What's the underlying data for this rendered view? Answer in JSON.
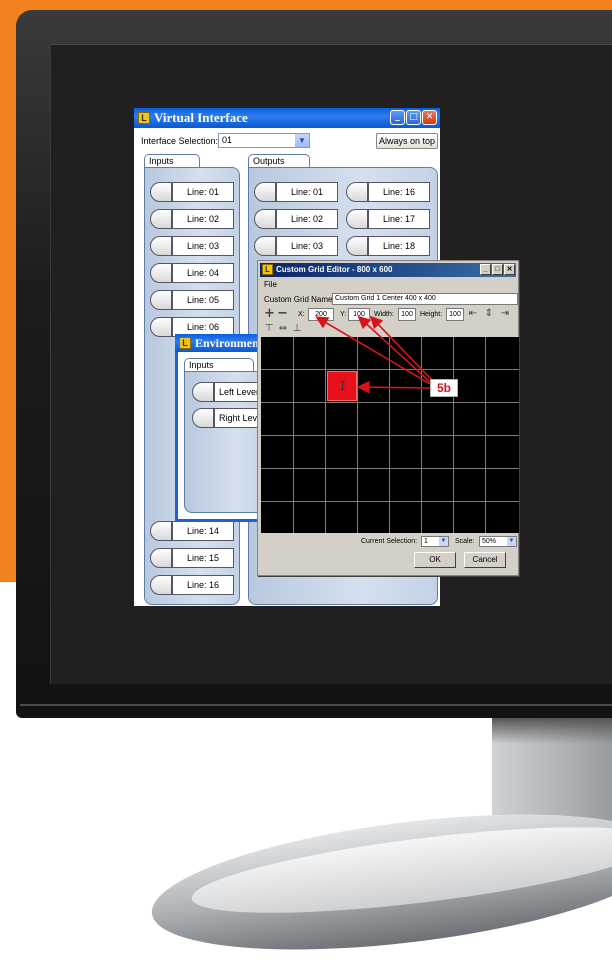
{
  "virtual_interface": {
    "title": "Virtual Interface",
    "selection_label": "Interface Selection:",
    "selection_value": "01",
    "always_on_top": "Always on top",
    "inputs_tab": "Inputs",
    "outputs_tab": "Outputs",
    "inputs": [
      "Line: 01",
      "Line: 02",
      "Line: 03",
      "Line: 04",
      "Line: 05",
      "Line: 06",
      "Line: 14",
      "Line: 15",
      "Line: 16"
    ],
    "outputs_col1": [
      "Line: 01",
      "Line: 02",
      "Line: 03"
    ],
    "outputs_col2": [
      "Line: 16",
      "Line: 17",
      "Line: 18"
    ]
  },
  "environment": {
    "title": "Environment",
    "inputs_tab": "Inputs",
    "levers": [
      "Left Lever",
      "Right Lever"
    ]
  },
  "grid_editor": {
    "title": "Custom Grid Editor - 800 x 600",
    "menu_file": "File",
    "name_label": "Custom Grid Name:",
    "name_value": "Custom Grid 1 Center 400 x 400",
    "x_label": "X:",
    "x_value": "200",
    "y_label": "Y:",
    "y_value": "100",
    "width_label": "Width:",
    "width_value": "100",
    "height_label": "Height:",
    "height_value": "100",
    "current_selection_label": "Current Selection:",
    "current_selection_value": "1",
    "scale_label": "Scale:",
    "scale_value": "50%",
    "ok": "OK",
    "cancel": "Cancel"
  },
  "annotation": {
    "label": "5b",
    "color": "#d7141b"
  },
  "colors": {
    "orange": "#f0821e",
    "screen": "#221f20",
    "selected_cell": "#e8101a"
  },
  "icons": [
    "app-icon",
    "minimize-icon",
    "maximize-icon",
    "close-icon",
    "add-icon",
    "remove-icon",
    "align-icon",
    "ibeam-cursor-icon",
    "dropdown-arrow-icon"
  ]
}
